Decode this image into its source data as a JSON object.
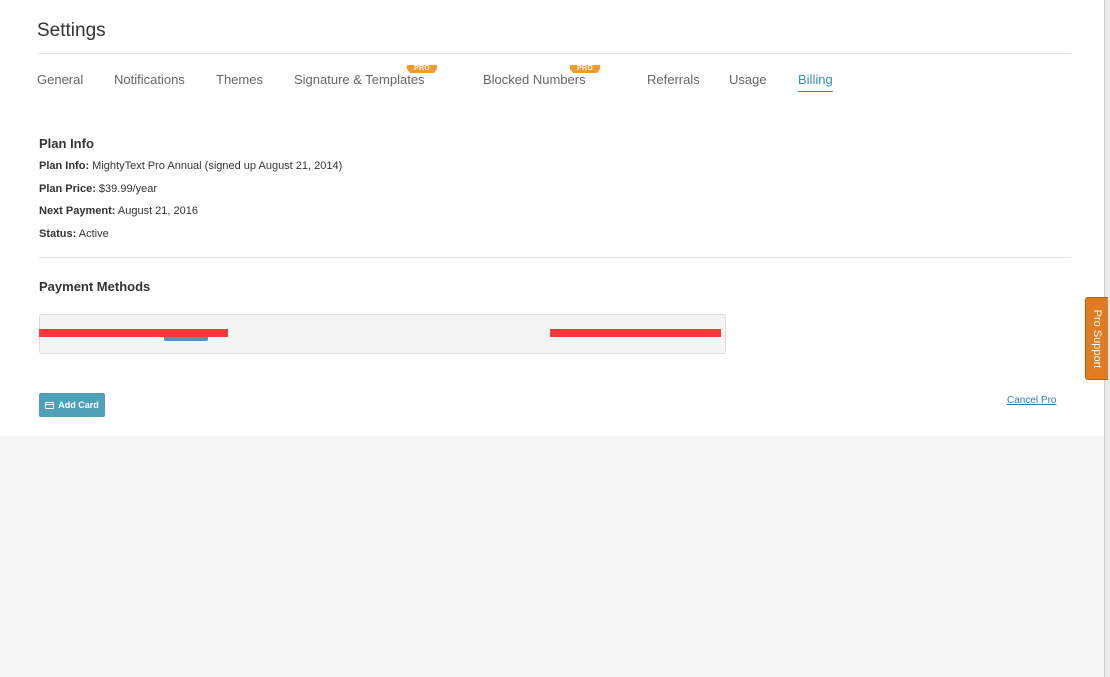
{
  "page": {
    "title": "Settings"
  },
  "tabs": [
    {
      "label": "General",
      "active": false,
      "pro": false
    },
    {
      "label": "Notifications",
      "active": false,
      "pro": false
    },
    {
      "label": "Themes",
      "active": false,
      "pro": false
    },
    {
      "label": "Signature & Templates",
      "active": false,
      "pro": true
    },
    {
      "label": "Blocked Numbers",
      "active": false,
      "pro": true
    },
    {
      "label": "Referrals",
      "active": false,
      "pro": false
    },
    {
      "label": "Usage",
      "active": false,
      "pro": false
    },
    {
      "label": "Billing",
      "active": true,
      "pro": false
    }
  ],
  "pro_badge": "PRO",
  "plan": {
    "heading": "Plan Info",
    "info_label": "Plan Info:",
    "info_value": "MightyText Pro Annual (signed up August 21, 2014)",
    "price_label": "Plan Price:",
    "price_value": "$39.99/year",
    "next_label": "Next Payment:",
    "next_value": "August 21, 2016",
    "status_label": "Status:",
    "status_value": "Active"
  },
  "payment": {
    "heading": "Payment Methods",
    "add_card_label": "Add Card",
    "cancel_label": "Cancel Pro"
  },
  "pro_support_label": "Pro Support",
  "colors": {
    "accent": "#2b93b5",
    "pro_badge": "#f39a2b",
    "redaction": "#f33a3a",
    "add_card": "#4ea0b9",
    "pro_support": "#e07c22"
  }
}
